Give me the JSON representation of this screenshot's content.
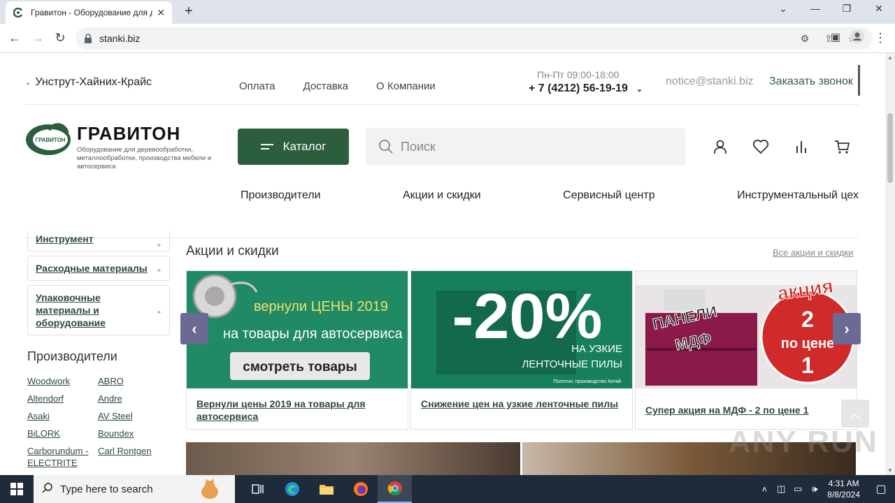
{
  "browser": {
    "tab_title": "Гравитон - Оборудование для д",
    "url": "stanki.biz",
    "new_tab_label": "+",
    "close_tab_label": "✕"
  },
  "topbar": {
    "city": "Унструт-Хайних-Крайс",
    "links": [
      "Оплата",
      "Доставка",
      "О Компании"
    ],
    "hours": "Пн-Пт 09:00-18:00",
    "phone": "+ 7 (4212) 56-19-19",
    "email": "notice@stanki.biz",
    "callback": "Заказать звонок"
  },
  "logo": {
    "name": "ГРАВИТОН",
    "emblem_text": "ГРАВИТОН",
    "tagline": "Оборудование для деревообработки, металлообработки, производства мебели и автосервиса"
  },
  "header": {
    "catalog_label": "Каталог",
    "search_placeholder": "Поиск"
  },
  "mainnav": [
    "Производители",
    "Акции и скидки",
    "Сервисный центр",
    "Инструментальный цех"
  ],
  "sidebar": {
    "cards": [
      "Инструмент",
      "Расходные материалы",
      "Упаковочные материалы и оборудование"
    ],
    "manufacturers_heading": "Производители",
    "brands": [
      "Woodwork",
      "ABRO",
      "Altendorf",
      "Andre",
      "Asaki",
      "AV Steel",
      "BiLORK",
      "Boundex",
      "Carborundum - ELECTRITE",
      "Carl Rontgen"
    ]
  },
  "promos": {
    "heading": "Акции и скидки",
    "all_link": "Все акции и скидки",
    "items": [
      {
        "caption": "Вернули цены 2019 на товары для автосервиса",
        "img_line1": "вернули ЦЕНЫ 2019",
        "img_line2": "на товары для автосервиса",
        "img_button": "смотреть товары"
      },
      {
        "caption": "Снижение цен на узкие ленточные пилы",
        "img_big": "-20%",
        "img_line1": "НА УЗКИЕ",
        "img_line2": "ЛЕНТОЧНЫЕ ПИЛЫ",
        "img_note": "Полотно: производство Китай"
      },
      {
        "caption": "Супер акция на МДФ - 2 по цене 1",
        "img_left1": "ПАНЕЛИ",
        "img_left2": "МДФ",
        "img_badge_top": "акция",
        "img_badge_num1": "2",
        "img_badge_mid": "по цене",
        "img_badge_num2": "1"
      }
    ]
  },
  "watermark": "ANY RUN",
  "taskbar": {
    "search_placeholder": "Type here to search",
    "time": "4:31 AM",
    "date": "8/8/2024"
  },
  "colors": {
    "brand_green": "#2b5e3d",
    "link_green": "#2f4a3a",
    "slider_arrow": "#6a6a95"
  }
}
